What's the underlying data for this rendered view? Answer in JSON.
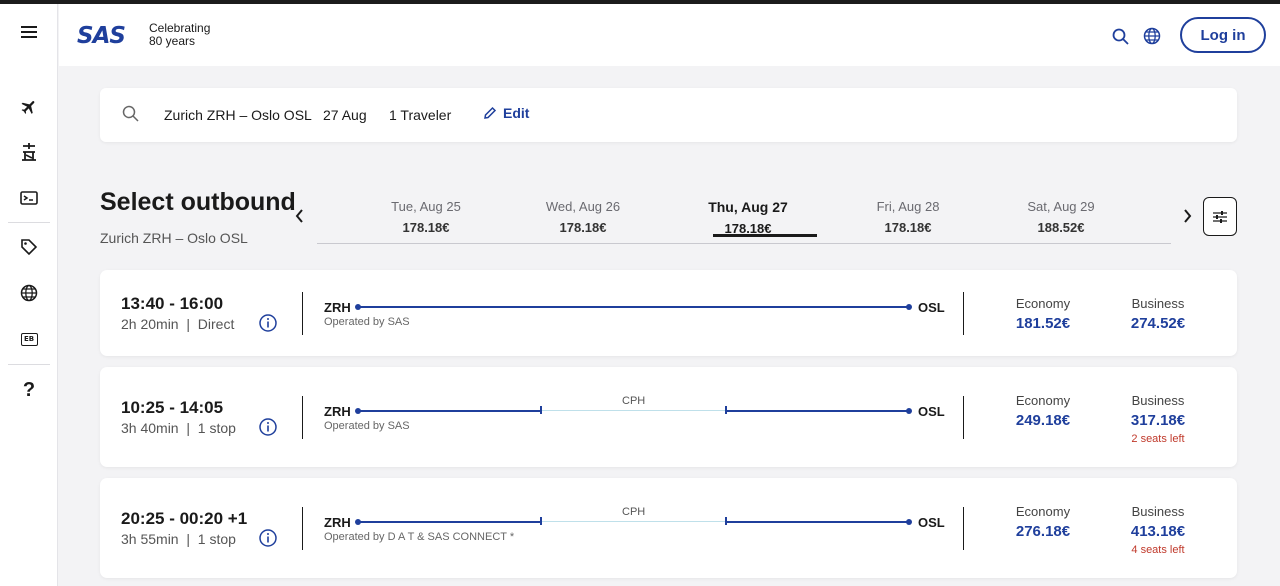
{
  "brand": {
    "logo": "SAS",
    "tagline_line1": "Celebrating",
    "tagline_line2": "80 years"
  },
  "header": {
    "login_label": "Log in",
    "icons": [
      "search-icon",
      "globe-icon"
    ]
  },
  "sidebar": {
    "items": [
      "menu-icon",
      "plane-icon",
      "travel-icon",
      "ticket-icon",
      "tag-icon",
      "globe-icon",
      "eurobonus-icon",
      "help-icon"
    ],
    "eurobonus_text": "EB",
    "help_text": "?"
  },
  "search": {
    "route": "Zurich ZRH – Oslo OSL",
    "date": "27 Aug",
    "travelers": "1 Traveler",
    "edit_label": "Edit"
  },
  "outbound": {
    "title": "Select outbound",
    "route": "Zurich ZRH – Oslo OSL"
  },
  "dates": [
    {
      "label": "Tue, Aug 25",
      "price": "178.18€",
      "active": false
    },
    {
      "label": "Wed, Aug 26",
      "price": "178.18€",
      "active": false
    },
    {
      "label": "Thu, Aug 27",
      "price": "178.18€",
      "active": true
    },
    {
      "label": "Fri, Aug 28",
      "price": "178.18€",
      "active": false
    },
    {
      "label": "Sat, Aug 29",
      "price": "188.52€",
      "active": false
    }
  ],
  "flights": [
    {
      "time": "13:40 - 16:00",
      "duration": "2h 20min",
      "stops": "Direct",
      "from": "ZRH",
      "to": "OSL",
      "via": "",
      "operated": "Operated by SAS",
      "economy_label": "Economy",
      "economy_price": "181.52€",
      "business_label": "Business",
      "business_price": "274.52€",
      "seats_left": ""
    },
    {
      "time": "10:25 - 14:05",
      "duration": "3h 40min",
      "stops": "1 stop",
      "from": "ZRH",
      "to": "OSL",
      "via": "CPH",
      "operated": "Operated by SAS",
      "economy_label": "Economy",
      "economy_price": "249.18€",
      "business_label": "Business",
      "business_price": "317.18€",
      "seats_left": "2 seats left"
    },
    {
      "time": "20:25 - 00:20 +1",
      "duration": "3h 55min",
      "stops": "1 stop",
      "from": "ZRH",
      "to": "OSL",
      "via": "CPH",
      "operated": "Operated by D A T & SAS CONNECT *",
      "economy_label": "Economy",
      "economy_price": "276.18€",
      "business_label": "Business",
      "business_price": "413.18€",
      "seats_left": "4 seats left"
    }
  ],
  "colors": {
    "brand_blue": "#1f3f9c",
    "seats_red": "#c0392b",
    "layover_line": "#bfe0ea"
  }
}
